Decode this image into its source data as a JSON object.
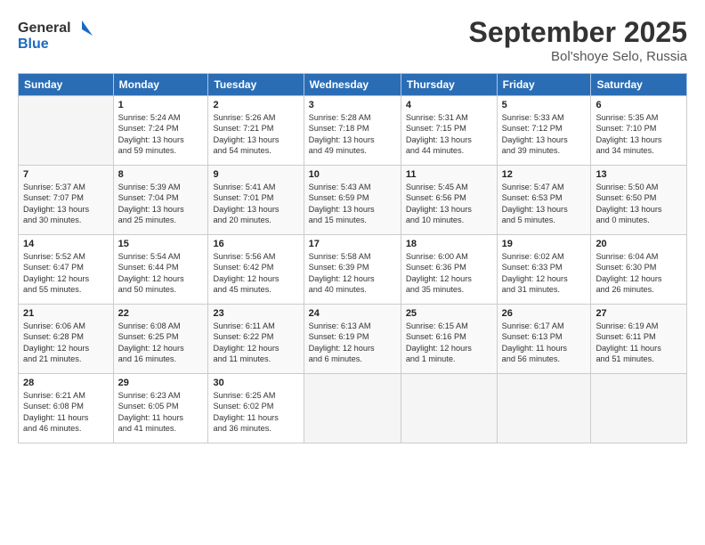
{
  "header": {
    "logo_line1": "General",
    "logo_line2": "Blue",
    "month": "September 2025",
    "location": "Bol'shoye Selo, Russia"
  },
  "columns": [
    "Sunday",
    "Monday",
    "Tuesday",
    "Wednesday",
    "Thursday",
    "Friday",
    "Saturday"
  ],
  "weeks": [
    [
      {
        "day": "",
        "info": ""
      },
      {
        "day": "1",
        "info": "Sunrise: 5:24 AM\nSunset: 7:24 PM\nDaylight: 13 hours\nand 59 minutes."
      },
      {
        "day": "2",
        "info": "Sunrise: 5:26 AM\nSunset: 7:21 PM\nDaylight: 13 hours\nand 54 minutes."
      },
      {
        "day": "3",
        "info": "Sunrise: 5:28 AM\nSunset: 7:18 PM\nDaylight: 13 hours\nand 49 minutes."
      },
      {
        "day": "4",
        "info": "Sunrise: 5:31 AM\nSunset: 7:15 PM\nDaylight: 13 hours\nand 44 minutes."
      },
      {
        "day": "5",
        "info": "Sunrise: 5:33 AM\nSunset: 7:12 PM\nDaylight: 13 hours\nand 39 minutes."
      },
      {
        "day": "6",
        "info": "Sunrise: 5:35 AM\nSunset: 7:10 PM\nDaylight: 13 hours\nand 34 minutes."
      }
    ],
    [
      {
        "day": "7",
        "info": "Sunrise: 5:37 AM\nSunset: 7:07 PM\nDaylight: 13 hours\nand 30 minutes."
      },
      {
        "day": "8",
        "info": "Sunrise: 5:39 AM\nSunset: 7:04 PM\nDaylight: 13 hours\nand 25 minutes."
      },
      {
        "day": "9",
        "info": "Sunrise: 5:41 AM\nSunset: 7:01 PM\nDaylight: 13 hours\nand 20 minutes."
      },
      {
        "day": "10",
        "info": "Sunrise: 5:43 AM\nSunset: 6:59 PM\nDaylight: 13 hours\nand 15 minutes."
      },
      {
        "day": "11",
        "info": "Sunrise: 5:45 AM\nSunset: 6:56 PM\nDaylight: 13 hours\nand 10 minutes."
      },
      {
        "day": "12",
        "info": "Sunrise: 5:47 AM\nSunset: 6:53 PM\nDaylight: 13 hours\nand 5 minutes."
      },
      {
        "day": "13",
        "info": "Sunrise: 5:50 AM\nSunset: 6:50 PM\nDaylight: 13 hours\nand 0 minutes."
      }
    ],
    [
      {
        "day": "14",
        "info": "Sunrise: 5:52 AM\nSunset: 6:47 PM\nDaylight: 12 hours\nand 55 minutes."
      },
      {
        "day": "15",
        "info": "Sunrise: 5:54 AM\nSunset: 6:44 PM\nDaylight: 12 hours\nand 50 minutes."
      },
      {
        "day": "16",
        "info": "Sunrise: 5:56 AM\nSunset: 6:42 PM\nDaylight: 12 hours\nand 45 minutes."
      },
      {
        "day": "17",
        "info": "Sunrise: 5:58 AM\nSunset: 6:39 PM\nDaylight: 12 hours\nand 40 minutes."
      },
      {
        "day": "18",
        "info": "Sunrise: 6:00 AM\nSunset: 6:36 PM\nDaylight: 12 hours\nand 35 minutes."
      },
      {
        "day": "19",
        "info": "Sunrise: 6:02 AM\nSunset: 6:33 PM\nDaylight: 12 hours\nand 31 minutes."
      },
      {
        "day": "20",
        "info": "Sunrise: 6:04 AM\nSunset: 6:30 PM\nDaylight: 12 hours\nand 26 minutes."
      }
    ],
    [
      {
        "day": "21",
        "info": "Sunrise: 6:06 AM\nSunset: 6:28 PM\nDaylight: 12 hours\nand 21 minutes."
      },
      {
        "day": "22",
        "info": "Sunrise: 6:08 AM\nSunset: 6:25 PM\nDaylight: 12 hours\nand 16 minutes."
      },
      {
        "day": "23",
        "info": "Sunrise: 6:11 AM\nSunset: 6:22 PM\nDaylight: 12 hours\nand 11 minutes."
      },
      {
        "day": "24",
        "info": "Sunrise: 6:13 AM\nSunset: 6:19 PM\nDaylight: 12 hours\nand 6 minutes."
      },
      {
        "day": "25",
        "info": "Sunrise: 6:15 AM\nSunset: 6:16 PM\nDaylight: 12 hours\nand 1 minute."
      },
      {
        "day": "26",
        "info": "Sunrise: 6:17 AM\nSunset: 6:13 PM\nDaylight: 11 hours\nand 56 minutes."
      },
      {
        "day": "27",
        "info": "Sunrise: 6:19 AM\nSunset: 6:11 PM\nDaylight: 11 hours\nand 51 minutes."
      }
    ],
    [
      {
        "day": "28",
        "info": "Sunrise: 6:21 AM\nSunset: 6:08 PM\nDaylight: 11 hours\nand 46 minutes."
      },
      {
        "day": "29",
        "info": "Sunrise: 6:23 AM\nSunset: 6:05 PM\nDaylight: 11 hours\nand 41 minutes."
      },
      {
        "day": "30",
        "info": "Sunrise: 6:25 AM\nSunset: 6:02 PM\nDaylight: 11 hours\nand 36 minutes."
      },
      {
        "day": "",
        "info": ""
      },
      {
        "day": "",
        "info": ""
      },
      {
        "day": "",
        "info": ""
      },
      {
        "day": "",
        "info": ""
      }
    ]
  ]
}
